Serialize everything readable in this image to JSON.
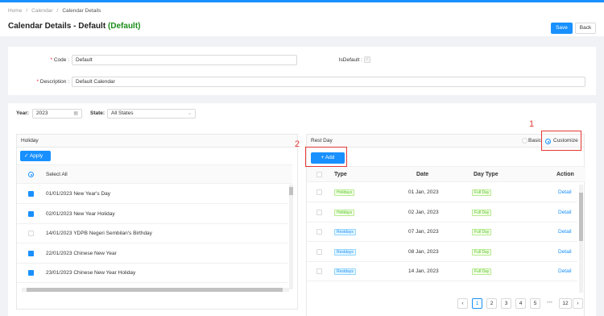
{
  "breadcrumb": [
    "Home",
    "Calendar",
    "Calendar Details"
  ],
  "title": {
    "main": "Calendar Details - Default",
    "tag": "(Default)"
  },
  "actions": {
    "save": "Save",
    "back": "Back"
  },
  "form": {
    "code_label": "Code :",
    "code_value": "Default",
    "isdefault_label": "IsDefault :",
    "description_label": "Description :",
    "description_value": "Default Calendar"
  },
  "filters": {
    "year_label": "Year:",
    "year_value": "2023",
    "state_label": "State:",
    "state_value": "All States"
  },
  "holiday": {
    "title": "Holiday",
    "apply": "Apply",
    "select_all": "Select All",
    "items": [
      {
        "label": "01/01/2023 New Year's Day",
        "checked": true
      },
      {
        "label": "02/01/2023 New Year Holiday",
        "checked": true
      },
      {
        "label": "14/01/2023 YDPB Negeri Sembilan's Birthday",
        "checked": false
      },
      {
        "label": "22/01/2023 Chinese New Year",
        "checked": true
      },
      {
        "label": "23/01/2023 Chinese New Year Holiday",
        "checked": true
      }
    ]
  },
  "restday": {
    "title": "Rest Day",
    "mode_basic": "Basic",
    "mode_customize": "Customize",
    "add": "Add",
    "columns": [
      "Type",
      "Date",
      "Day Type",
      "Action"
    ],
    "rows": [
      {
        "type": "Holidays",
        "date": "01 Jan, 2023",
        "day_type": "Full Day",
        "action": "Detail"
      },
      {
        "type": "Holidays",
        "date": "02 Jan, 2023",
        "day_type": "Full Day",
        "action": "Detail"
      },
      {
        "type": "Restdays",
        "date": "07 Jan, 2023",
        "day_type": "Full Day",
        "action": "Detail"
      },
      {
        "type": "Restdays",
        "date": "08 Jan, 2023",
        "day_type": "Full Day",
        "action": "Detail"
      },
      {
        "type": "Restdays",
        "date": "14 Jan, 2023",
        "day_type": "Full Day",
        "action": "Detail"
      }
    ]
  },
  "pagination": {
    "pages": [
      "1",
      "2",
      "3",
      "4",
      "5",
      "•••",
      "12"
    ],
    "current": "1"
  },
  "annotations": {
    "one": "1",
    "two": "2"
  },
  "colors": {
    "accent": "#1890ff",
    "default_tag": "#1a8c1a",
    "annotation": "#e53935"
  }
}
